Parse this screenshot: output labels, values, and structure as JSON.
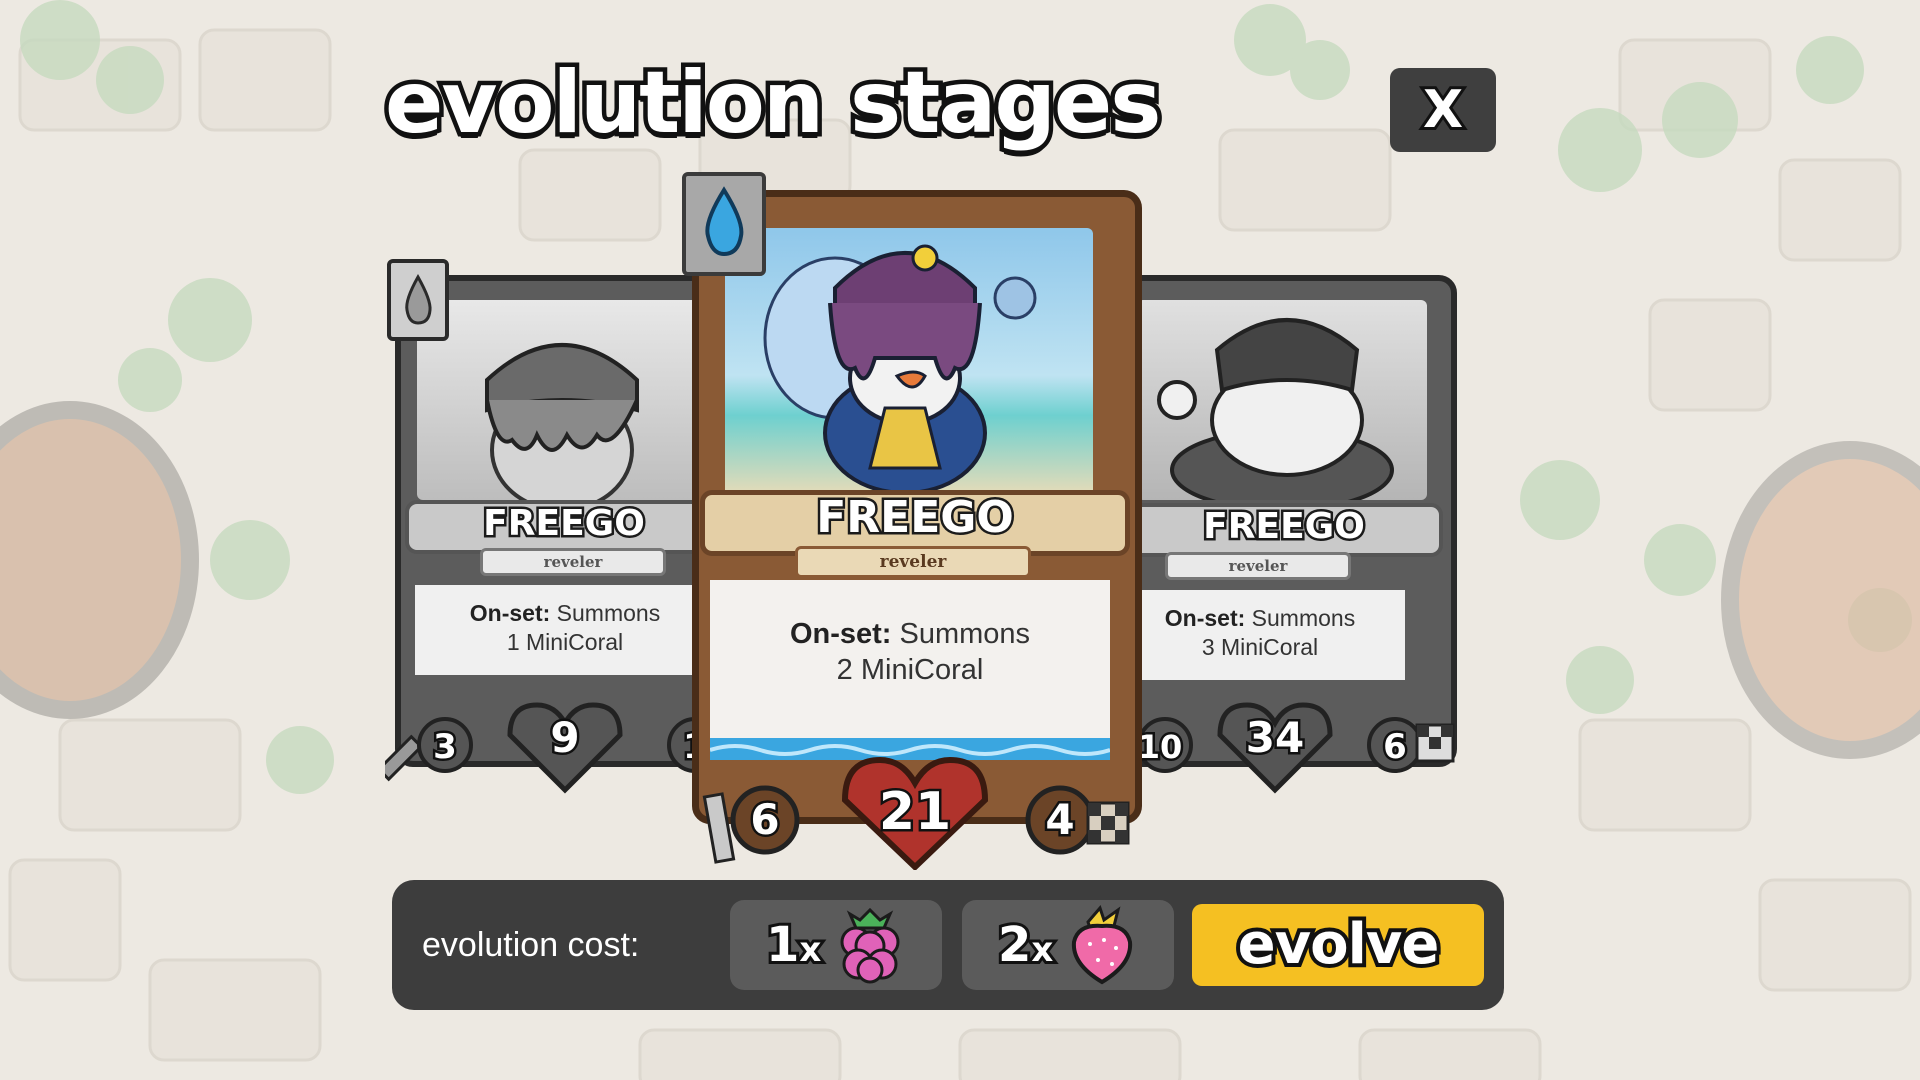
{
  "title": "evolution stages",
  "close_label": "X",
  "cards": [
    {
      "name": "FREEGO",
      "subtype": "reveler",
      "ability_label": "On-set:",
      "ability_text": "Summons",
      "ability_line2": "1 MiniCoral",
      "attack": "3",
      "health": "9",
      "speed": "1",
      "element_icon": "water-drop-icon",
      "state": "greyed"
    },
    {
      "name": "FREEGO",
      "subtype": "reveler",
      "ability_label": "On-set:",
      "ability_text": "Summons",
      "ability_line2": "2 MiniCoral",
      "attack": "6",
      "health": "21",
      "speed": "4",
      "element_icon": "water-drop-icon",
      "state": "active"
    },
    {
      "name": "FREEGO",
      "subtype": "reveler",
      "ability_label": "On-set:",
      "ability_text": "Summons",
      "ability_line2": "3 MiniCoral",
      "attack": "10",
      "health": "34",
      "speed": "6",
      "element_icon": "water-drop-icon",
      "state": "greyed"
    }
  ],
  "cost": {
    "label": "evolution cost:",
    "items": [
      {
        "qty": "1",
        "x": "x",
        "icon": "raspberry-icon"
      },
      {
        "qty": "2",
        "x": "x",
        "icon": "strawberry-icon"
      }
    ]
  },
  "evolve_label": "evolve",
  "colors": {
    "accent": "#f5c022",
    "bar": "#3d3d3d",
    "slot": "#5b5b5b",
    "wood": "#8a5a35",
    "water": "#3aa6e0",
    "berry": "#e062b8"
  }
}
